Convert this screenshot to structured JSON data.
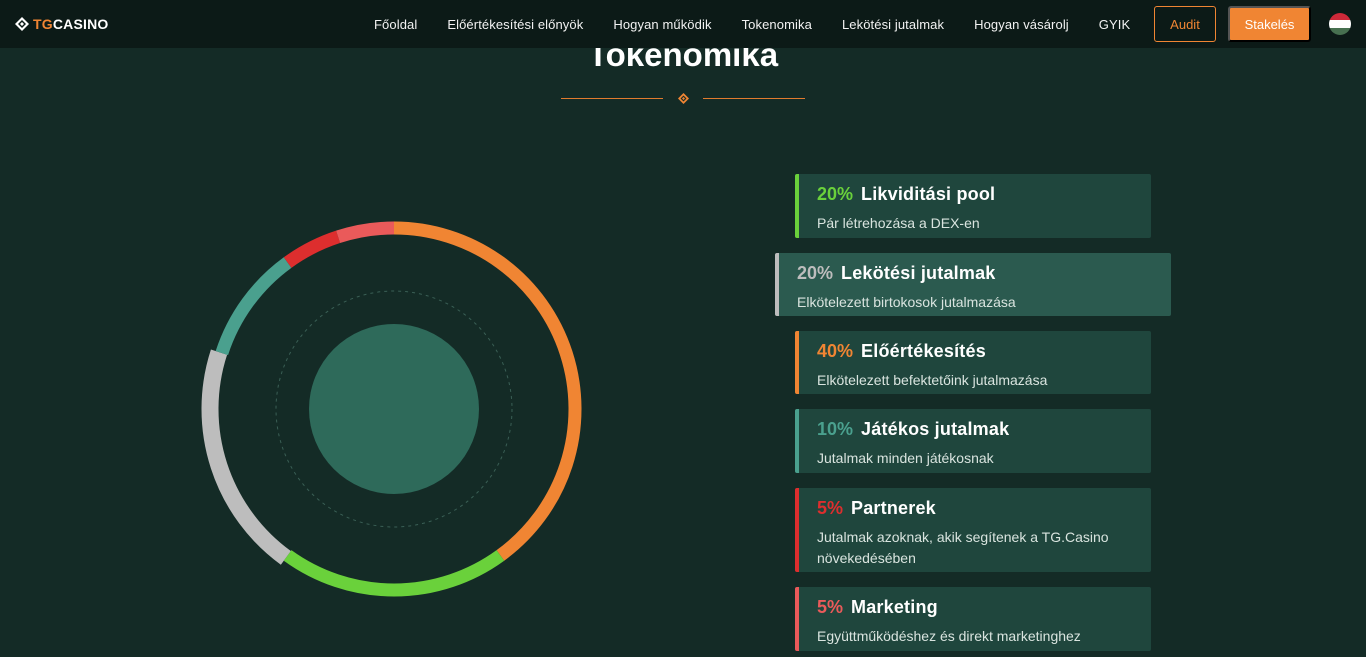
{
  "header": {
    "logo_tg": "TG",
    "logo_casino": "CASINO",
    "nav": [
      {
        "label": "Főoldal"
      },
      {
        "label": "Előértékesítési előnyök"
      },
      {
        "label": "Hogyan működik"
      },
      {
        "label": "Tokenomika"
      },
      {
        "label": "Lekötési jutalmak"
      },
      {
        "label": "Hogyan vásárolj"
      },
      {
        "label": "GYIK"
      }
    ],
    "audit_label": "Audit",
    "stake_label": "Stakelés",
    "language_flag": "hungarian-flag",
    "flag_colors": [
      "#ce2939",
      "#ffffff",
      "#477050"
    ]
  },
  "section": {
    "title": "Tokenomika",
    "divider_icon": "diamond-icon"
  },
  "colors": {
    "accent": "#f08533",
    "background": "#142b26",
    "topbar": "#0c1a17",
    "card": "#1f463d",
    "card_active": "#2b5a4f",
    "inner_disc": "#2e6a5a"
  },
  "chart_data": {
    "type": "pie",
    "style": "donut",
    "categories": [
      "Likviditási pool",
      "Lekötési jutalmak",
      "Előértékesítés",
      "Játékos jutalmak",
      "Partnerek",
      "Marketing"
    ],
    "values": [
      20,
      20,
      40,
      10,
      5,
      5
    ],
    "colors": [
      "#6ad13b",
      "#bdbdbd",
      "#f08533",
      "#4aa08e",
      "#dd2e2e",
      "#ea5a5a"
    ],
    "legend_position": "right"
  },
  "legend": [
    {
      "percent": "20%",
      "title": "Likviditási pool",
      "description": "Pár létrehozása a DEX-en",
      "color": "#6ad13b",
      "active": false
    },
    {
      "percent": "20%",
      "title": "Lekötési jutalmak",
      "description": "Elkötelezett birtokosok jutalmazása",
      "color": "#bdbdbd",
      "active": true
    },
    {
      "percent": "40%",
      "title": "Előértékesítés",
      "description": "Elkötelezett befektetőink jutalmazása",
      "color": "#f08533",
      "active": false
    },
    {
      "percent": "10%",
      "title": "Játékos jutalmak",
      "description": "Jutalmak minden játékosnak",
      "color": "#4aa08e",
      "active": false
    },
    {
      "percent": "5%",
      "title": "Partnerek",
      "description": "Jutalmak azoknak, akik segítenek a TG.Casino növekedésében",
      "color": "#dd2e2e",
      "active": false
    },
    {
      "percent": "5%",
      "title": "Marketing",
      "description": "Együttműködéshez és direkt marketinghez",
      "color": "#ea5a5a",
      "active": false
    }
  ]
}
